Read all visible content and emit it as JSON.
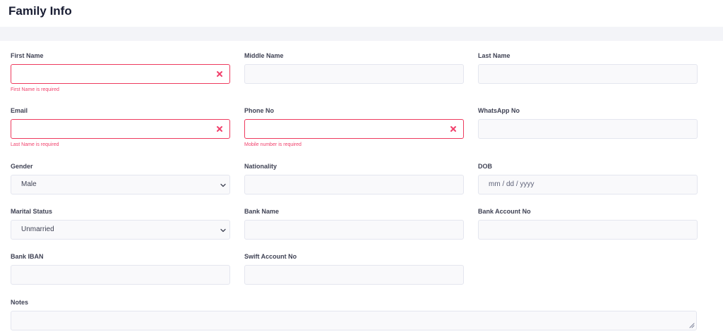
{
  "page": {
    "title": "Family Info"
  },
  "form": {
    "first_name": {
      "label": "First Name",
      "value": "",
      "error": "First Name is required"
    },
    "middle_name": {
      "label": "Middle Name",
      "value": ""
    },
    "last_name": {
      "label": "Last Name",
      "value": ""
    },
    "email": {
      "label": "Email",
      "value": "",
      "error": "Last Name is required"
    },
    "phone": {
      "label": "Phone No",
      "value": "",
      "error": "Mobile number is required"
    },
    "whatsapp": {
      "label": "WhatsApp No",
      "value": ""
    },
    "gender": {
      "label": "Gender",
      "selected": "Male"
    },
    "nationality": {
      "label": "Nationality",
      "value": ""
    },
    "dob": {
      "label": "DOB",
      "placeholder": "mm / dd / yyyy"
    },
    "marital_status": {
      "label": "Marital Status",
      "selected": "Unmarried"
    },
    "bank_name": {
      "label": "Bank Name",
      "value": ""
    },
    "bank_account": {
      "label": "Bank Account No",
      "value": ""
    },
    "bank_iban": {
      "label": "Bank IBAN",
      "value": ""
    },
    "swift": {
      "label": "Swift Account No",
      "value": ""
    },
    "notes": {
      "label": "Notes",
      "value": ""
    }
  },
  "colors": {
    "error": "#f1416c",
    "input_bg": "#f9f9fb",
    "border": "#e4e6ef",
    "title": "#181c32"
  },
  "icons": {
    "clear": "x-mark-icon",
    "dropdown": "chevron-down-icon",
    "resize": "resize-grip-icon"
  }
}
